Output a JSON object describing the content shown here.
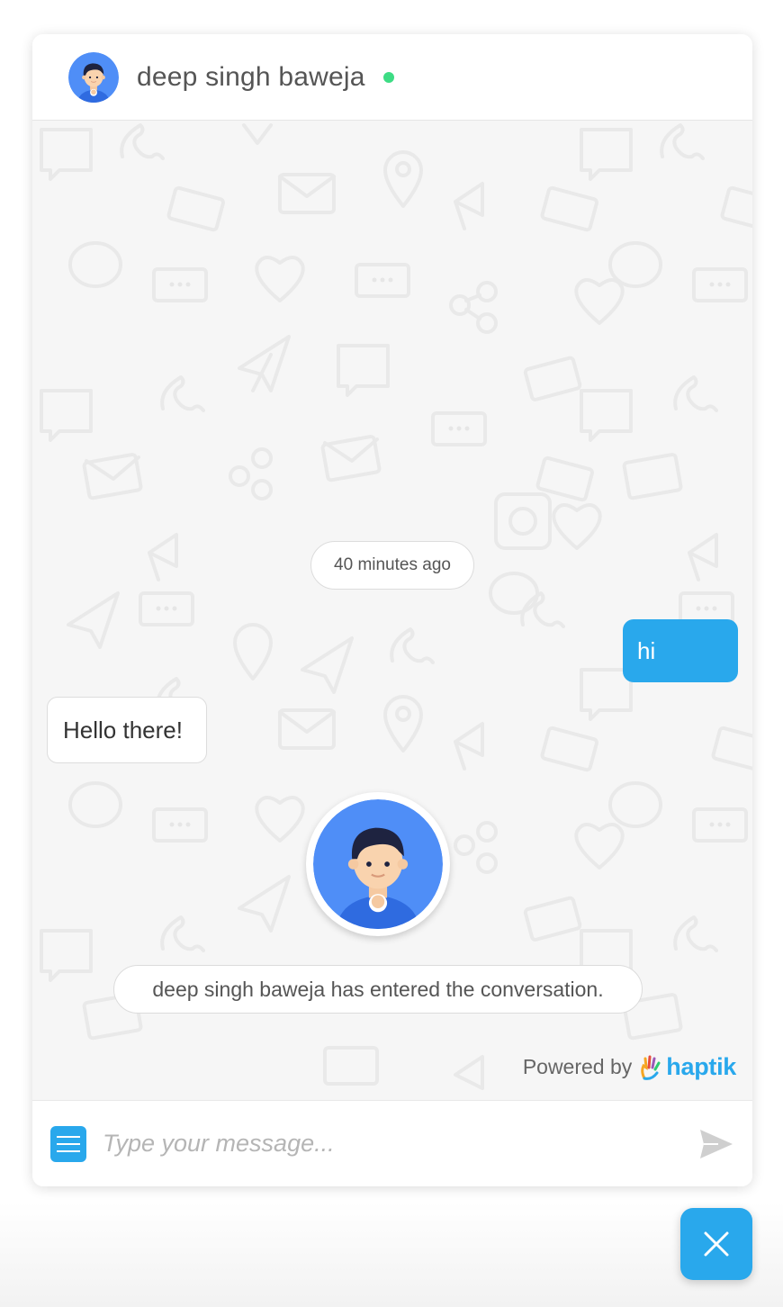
{
  "header": {
    "agent_name": "deep singh baweja",
    "status": "online",
    "status_color": "#3ddc84",
    "avatar_icon": "agent-avatar-icon"
  },
  "chat": {
    "timestamp": "40 minutes ago",
    "messages": [
      {
        "from": "user",
        "text": "hi"
      },
      {
        "from": "agent",
        "text": "Hello there!"
      }
    ],
    "system_message": "deep singh baweja has entered the conversation.",
    "powered_by_label": "Powered by",
    "brand_name": "haptik"
  },
  "composer": {
    "placeholder": "Type your message...",
    "menu_icon": "menu-icon",
    "send_icon": "send-icon"
  },
  "close_button": {
    "icon": "close-icon"
  },
  "colors": {
    "accent": "#29a8ec",
    "chat_background": "#f6f6f6",
    "avatar_background": "#4f8ef7"
  }
}
